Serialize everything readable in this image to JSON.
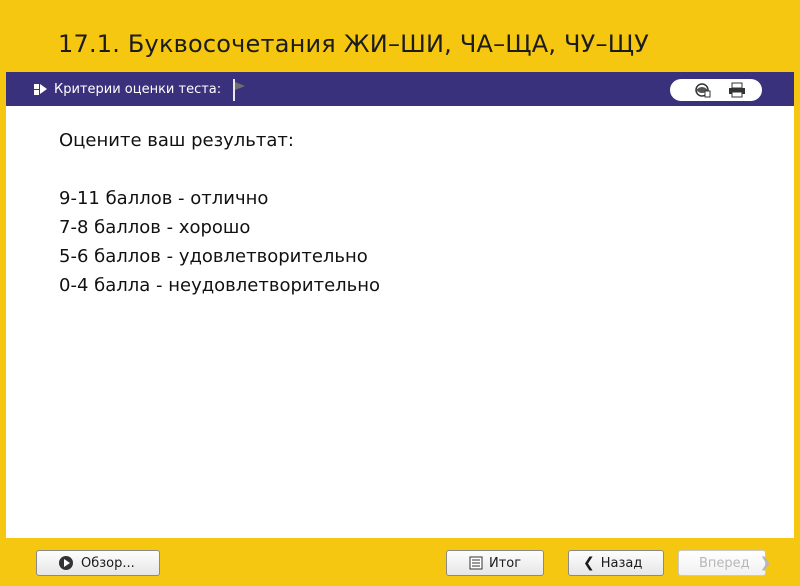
{
  "title": "17.1. Буквосочетания ЖИ–ШИ, ЧА–ЩА, ЧУ–ЩУ",
  "toolbar": {
    "criteria_label": "Критерии оценки теста:",
    "icons": [
      "criteria-arrow-icon",
      "flag-icon",
      "globe-icon",
      "print-icon"
    ]
  },
  "content": {
    "heading": "Оцените ваш результат:",
    "lines": [
      "9-11 баллов - отлично",
      "7-8 баллов - хорошо",
      "5-6 баллов - удовлетворительно",
      "0-4 балла - неудовлетворительно"
    ]
  },
  "footer": {
    "review_label": "Обзор...",
    "result_label": "Итог",
    "back_label": "Назад",
    "next_label": "Вперед"
  },
  "colors": {
    "frame": "#f6c710",
    "toolbar": "#3a317d",
    "content_bg": "#ffffff"
  }
}
